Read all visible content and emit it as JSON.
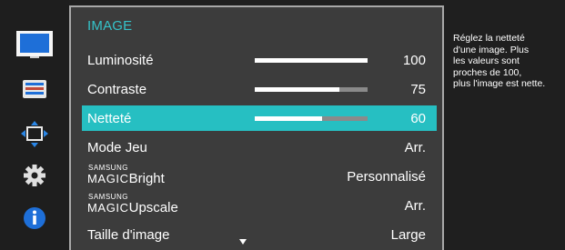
{
  "colors": {
    "accent": "#35c3c9",
    "selected_row": "#26bfc2",
    "panel_bg": "#3c3c3c",
    "osd_bg": "#1f1f1f"
  },
  "sidebar": {
    "icons": [
      {
        "name": "monitor-picture-icon",
        "selected": true
      },
      {
        "name": "onscreen-display-icon",
        "selected": false
      },
      {
        "name": "position-arrows-icon",
        "selected": false
      },
      {
        "name": "gear-icon",
        "selected": false
      },
      {
        "name": "info-icon",
        "selected": false
      }
    ]
  },
  "menu": {
    "title": "IMAGE",
    "items": [
      {
        "label": "Luminosité",
        "value": "100",
        "bar": 1.0
      },
      {
        "label": "Contraste",
        "value": "75",
        "bar": 0.75
      },
      {
        "label": "Netteté",
        "value": "60",
        "bar": 0.6,
        "selected": true
      },
      {
        "label": "Mode Jeu",
        "value": "Arr."
      },
      {
        "brand_top": "SAMSUNG",
        "brand_magic": "MAGIC",
        "label": "Bright",
        "value": "Personnalisé"
      },
      {
        "brand_top": "SAMSUNG",
        "brand_magic": "MAGIC",
        "label": "Upscale",
        "value": "Arr."
      },
      {
        "label": "Taille d'image",
        "value": "Large"
      }
    ]
  },
  "help": {
    "lines": [
      "Réglez la netteté",
      "d'une image. Plus",
      "les valeurs sont",
      "proches de 100,",
      "plus l'image est nette."
    ]
  }
}
